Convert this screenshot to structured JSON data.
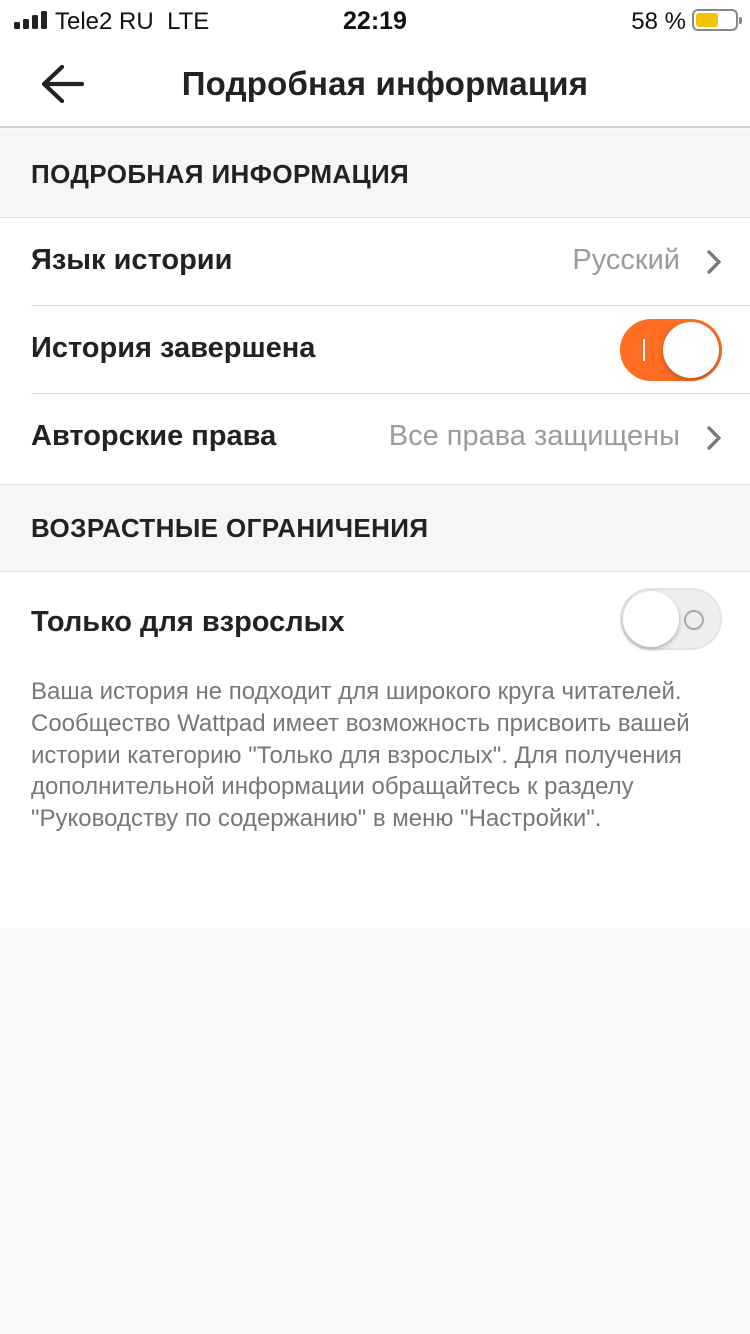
{
  "status_bar": {
    "carrier": "Tele2 RU",
    "network": "LTE",
    "time": "22:19",
    "battery_percent": "58 %"
  },
  "header": {
    "title": "Подробная информация",
    "back_icon": "back-arrow-icon"
  },
  "section_details": {
    "title": "ПОДРОБНАЯ ИНФОРМАЦИЯ",
    "rows": [
      {
        "label": "Язык истории",
        "value": "Русский"
      },
      {
        "label": "История завершена",
        "toggle_on": true
      },
      {
        "label": "Авторские права",
        "value": "Все права защищены"
      }
    ]
  },
  "section_age": {
    "title": "ВОЗРАСТНЫЕ ОГРАНИЧЕНИЯ",
    "mature_label": "Только для взрослых",
    "mature_toggle_on": false,
    "description": "Ваша история не подходит для широкого круга читателей. Сообщество Wattpad имеет возможность присвоить вашей истории категорию \"Только для взрослых\". Для получения дополнительной информации обращайтесь к разделу  \"Руководству по содержанию\" в меню \"Настройки\"."
  },
  "colors": {
    "accent": "#ff6d22",
    "battery": "#f5c400",
    "background": "#f9f8fb"
  }
}
